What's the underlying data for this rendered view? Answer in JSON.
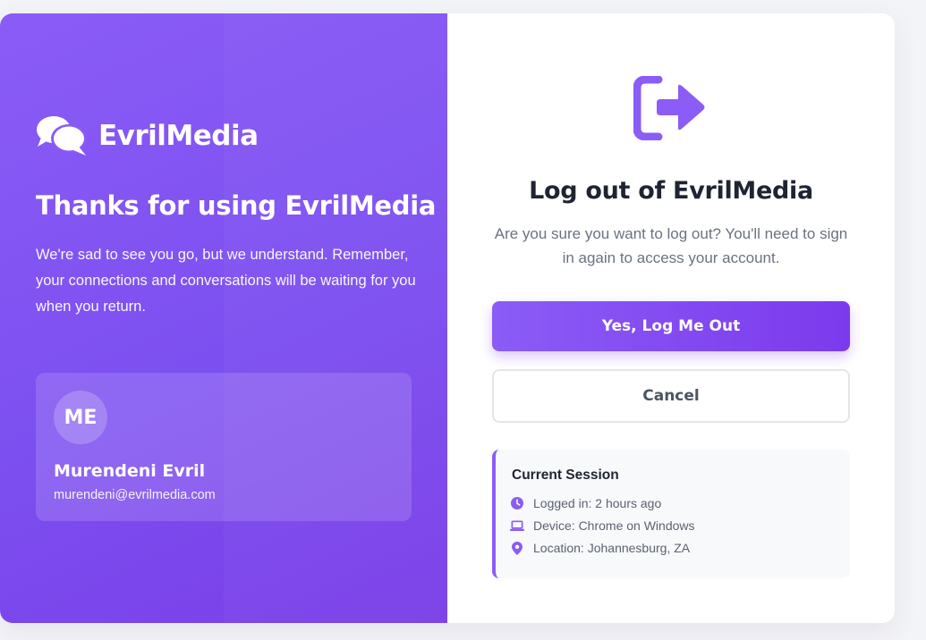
{
  "brand": {
    "name": "EvrilMedia",
    "icon": "chat-bubbles-icon"
  },
  "left": {
    "heading": "Thanks for using EvrilMedia",
    "message": "We're sad to see you go, but we understand. Remember, your connections and conversations will be waiting for you when you return."
  },
  "user": {
    "initials": "ME",
    "name": "Murendeni Evril",
    "email": "murendeni@evrilmedia.com"
  },
  "dialog": {
    "icon": "sign-out-icon",
    "title": "Log out of EvrilMedia",
    "subtitle": "Are you sure you want to log out? You'll need to sign in again to access your account.",
    "confirm_label": "Yes, Log Me Out",
    "cancel_label": "Cancel"
  },
  "session": {
    "title": "Current Session",
    "logged_in": "Logged in: 2 hours ago",
    "device": "Device: Chrome on Windows",
    "location": "Location: Johannesburg, ZA"
  },
  "colors": {
    "accent": "#8b5cf6",
    "accent_dark": "#7c3aed",
    "text_dark": "#1f2433",
    "text_muted": "#6b7280"
  }
}
